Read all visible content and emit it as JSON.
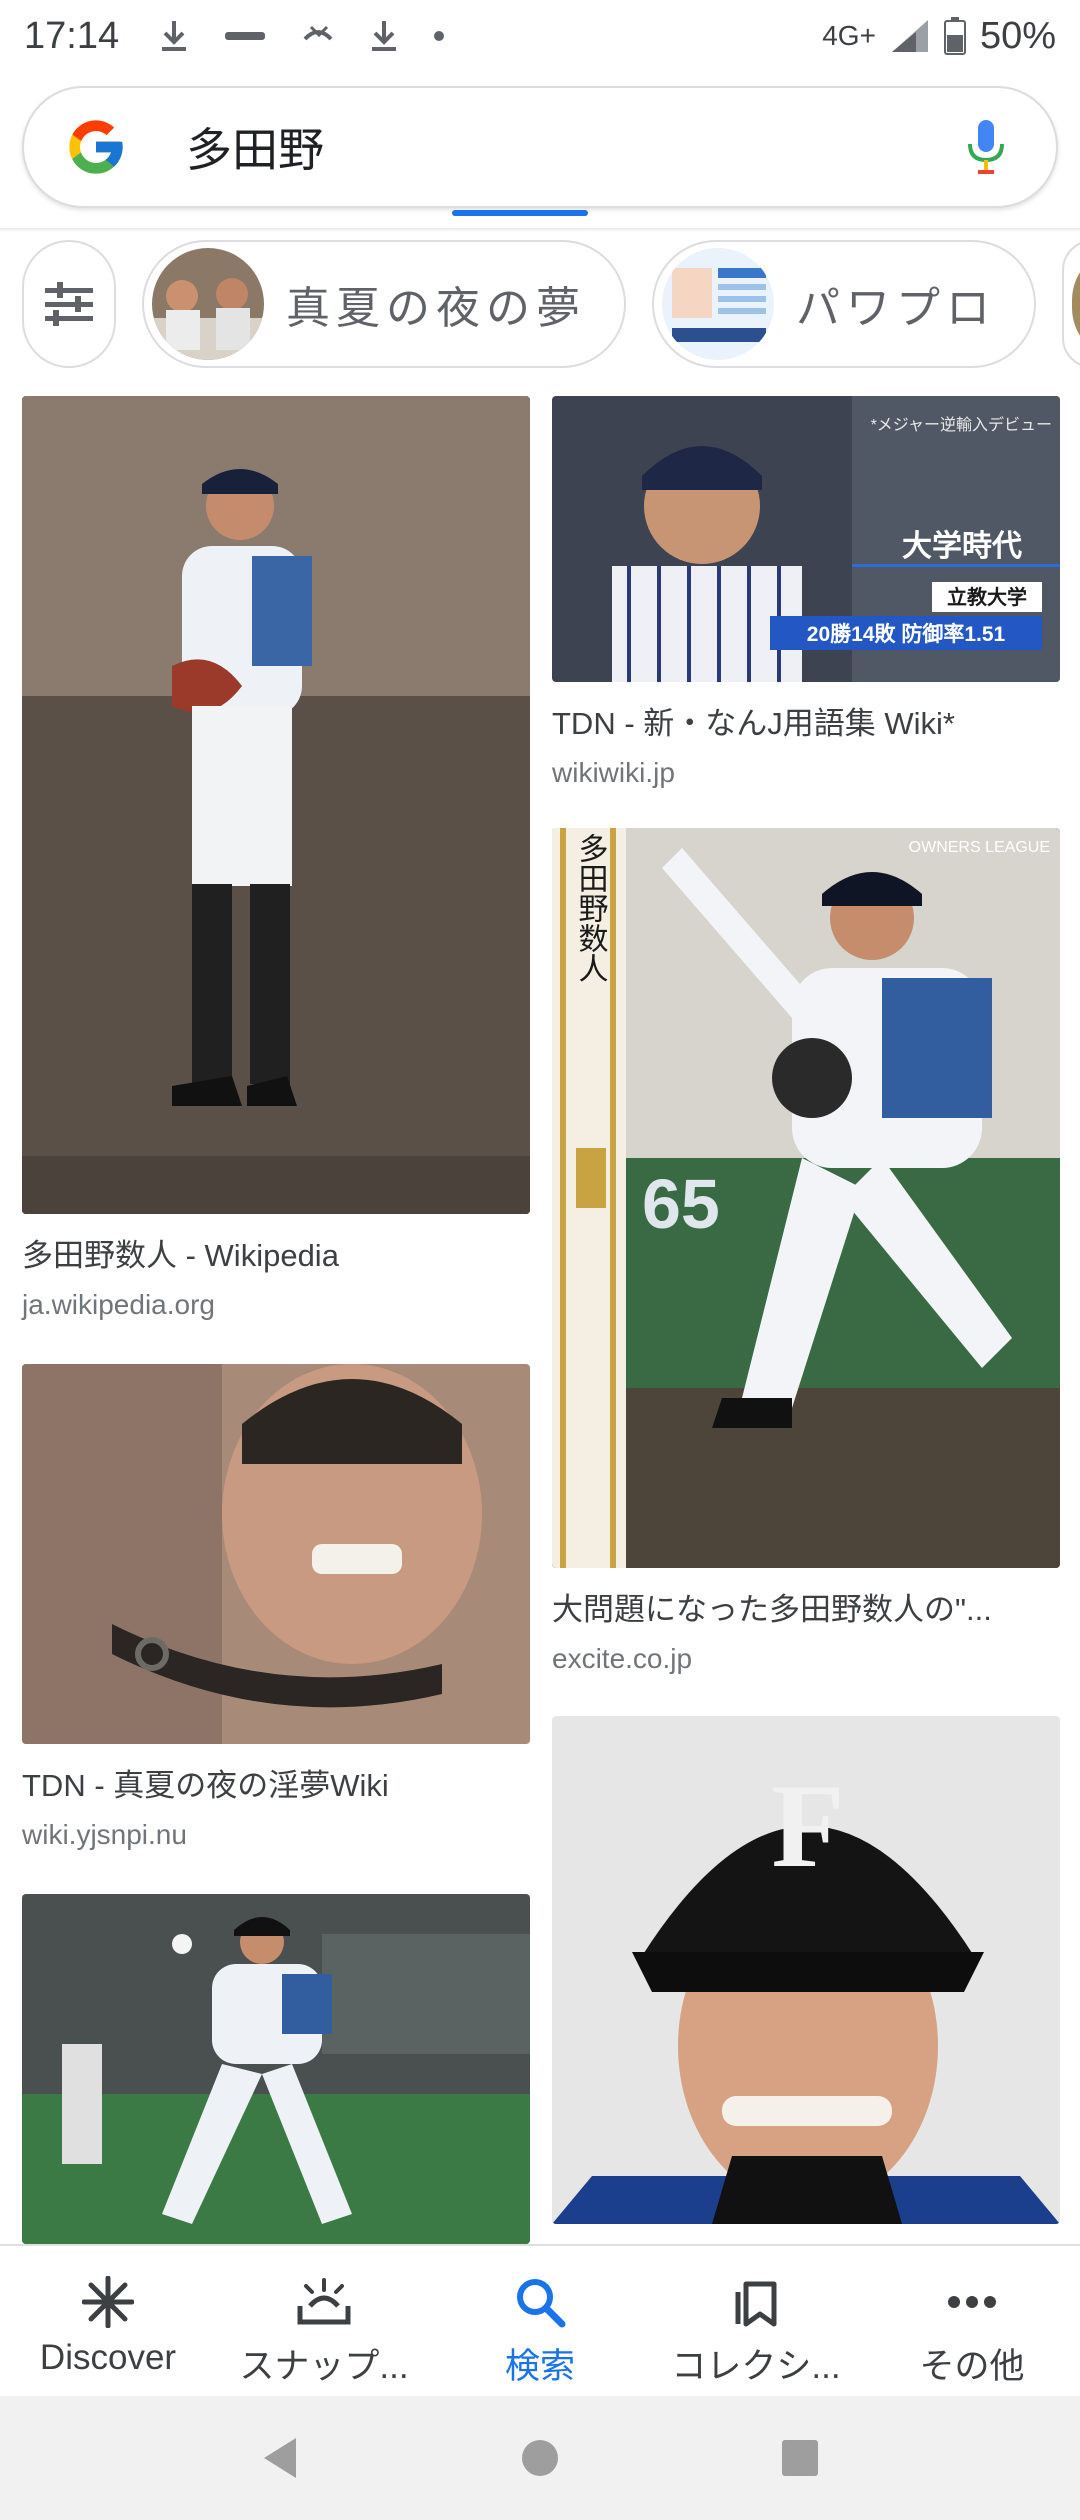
{
  "status_bar": {
    "time": "17:14",
    "network": "4G+",
    "battery": "50%"
  },
  "search": {
    "query": "多田野"
  },
  "chips": [
    {
      "label": "真夏の夜の夢"
    },
    {
      "label": "パワプロ"
    }
  ],
  "results": [
    {
      "title": "多田野数人 - Wikipedia",
      "domain": "ja.wikipedia.org"
    },
    {
      "title": "TDN - 新・なんJ用語集 Wiki*",
      "domain": "wikiwiki.jp",
      "overlay": {
        "line1": "*メジャー逆輸入デビュー",
        "line2": "大学時代",
        "line3": "立教大学",
        "line4": "20勝14敗 防御率1.51"
      }
    },
    {
      "title": "TDN - 真夏の夜の淫夢Wiki",
      "domain": "wiki.yjsnpi.nu"
    },
    {
      "title": "大問題になった多田野数人の\"...",
      "domain": "excite.co.jp",
      "card_text": {
        "name": "多田野数人",
        "number": "65",
        "brand": "OWNERS LEAGUE"
      }
    },
    {
      "title": "",
      "domain": ""
    },
    {
      "title": "",
      "domain": ""
    }
  ],
  "bottom_nav": [
    {
      "label": "Discover",
      "icon": "asterisk-icon"
    },
    {
      "label": "スナップ...",
      "icon": "snapshot-icon"
    },
    {
      "label": "検索",
      "icon": "search-icon",
      "active": true
    },
    {
      "label": "コレクシ...",
      "icon": "collections-icon"
    },
    {
      "label": "その他",
      "icon": "more-icon"
    }
  ],
  "colors": {
    "accent": "#1a73e8",
    "text_primary": "#3c4043",
    "text_secondary": "#70757a"
  }
}
